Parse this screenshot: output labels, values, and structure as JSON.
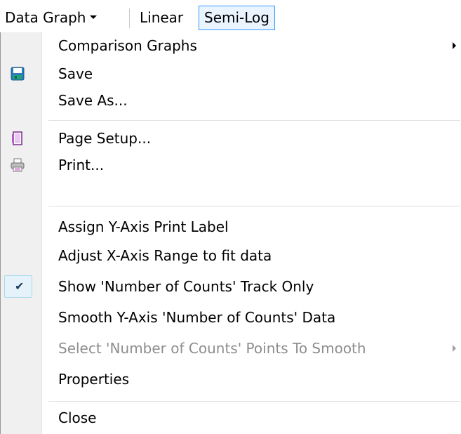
{
  "toolbar": {
    "dropdown_label": "Data Graph",
    "linear_label": "Linear",
    "semilog_label": "Semi-Log"
  },
  "menu": {
    "items": [
      {
        "label": "Comparison Graphs",
        "submenu": true,
        "icon": "none"
      },
      {
        "label": "Save",
        "icon": "save-icon"
      },
      {
        "label": "Save As...",
        "icon": "none"
      },
      {
        "label": "Page Setup...",
        "icon": "page-setup-icon"
      },
      {
        "label": "Print...",
        "icon": "printer-icon"
      },
      {
        "label": "Assign Y-Axis Print Label"
      },
      {
        "label": "Adjust X-Axis Range to fit data"
      },
      {
        "label": "Show 'Number of Counts' Track Only",
        "checked": true
      },
      {
        "label": "Smooth Y-Axis 'Number of Counts' Data"
      },
      {
        "label": "Select 'Number of Counts' Points To Smooth",
        "disabled": true,
        "submenu": true
      },
      {
        "label": "Properties"
      },
      {
        "label": "Close"
      }
    ]
  },
  "colors": {
    "accent_border": "#3399ff",
    "check_bg": "#e6f2fa",
    "disabled_text": "#8d8d8d"
  }
}
